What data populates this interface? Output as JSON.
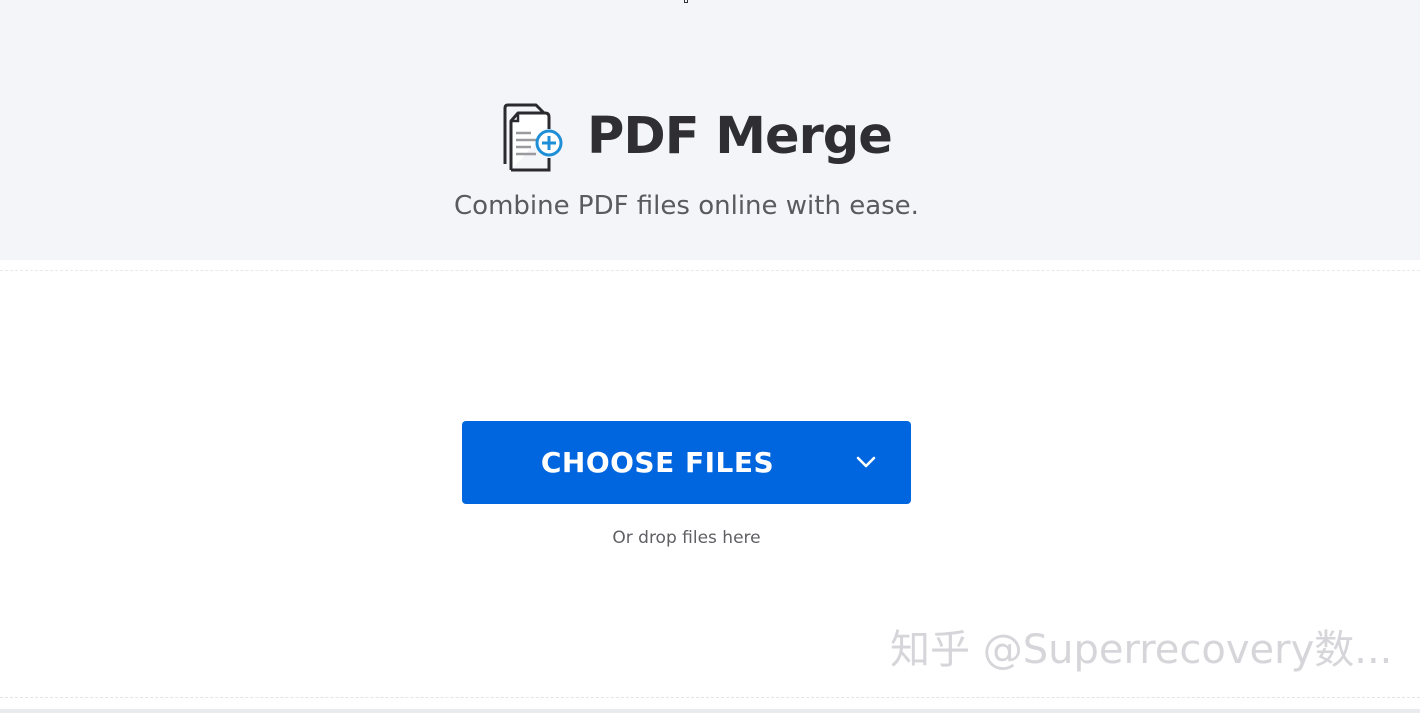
{
  "header": {
    "title": "PDF Merge",
    "subtitle": "Combine PDF files online with ease.",
    "logo_icon": "merge-documents-icon"
  },
  "upload": {
    "choose_files_label": "CHOOSE FILES",
    "dropdown_icon": "chevron-down-icon",
    "drop_hint": "Or drop files here"
  },
  "watermark": {
    "text": "知乎 @Superrecovery数..."
  },
  "colors": {
    "hero_background": "#f4f5f8",
    "button_blue": "#0066e0",
    "title_text": "#2f2f33",
    "icon_accent": "#1e8fd6"
  }
}
